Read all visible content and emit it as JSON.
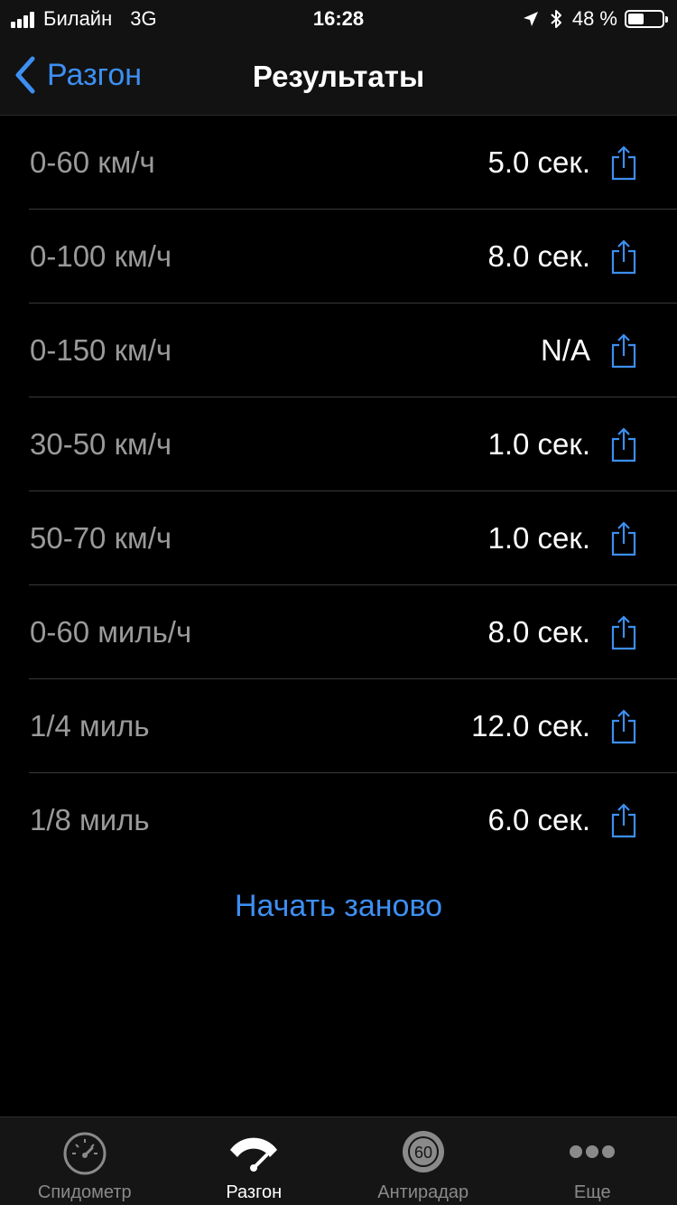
{
  "status_bar": {
    "carrier": "Билайн",
    "network": "3G",
    "time": "16:28",
    "battery_percent": "48 %",
    "battery_level": 0.48,
    "icons": [
      "signal-icon",
      "location-arrow-icon",
      "bluetooth-icon",
      "battery-icon"
    ]
  },
  "nav": {
    "back_label": "Разгон",
    "title": "Результаты"
  },
  "results": [
    {
      "label": "0-60 км/ч",
      "value": "5.0 сек."
    },
    {
      "label": "0-100 км/ч",
      "value": "8.0 сек."
    },
    {
      "label": "0-150 км/ч",
      "value": "N/A"
    },
    {
      "label": "30-50 км/ч",
      "value": "1.0 сек."
    },
    {
      "label": "50-70 км/ч",
      "value": "1.0 сек."
    },
    {
      "label": "0-60 миль/ч",
      "value": "8.0 сек."
    },
    {
      "label": "1/4 миль",
      "value": "12.0 сек."
    },
    {
      "label": "1/8 миль",
      "value": "6.0 сек."
    }
  ],
  "restart_label": "Начать заново",
  "tabs": [
    {
      "label": "Спидометр",
      "icon": "speedometer-icon",
      "active": false
    },
    {
      "label": "Разгон",
      "icon": "acceleration-gauge-icon",
      "active": true
    },
    {
      "label": "Антирадар",
      "icon": "speed-limit-sign-icon",
      "active": false,
      "icon_text": "60"
    },
    {
      "label": "Еще",
      "icon": "more-dots-icon",
      "active": false
    }
  ],
  "colors": {
    "accent": "#3d8ff2",
    "background": "#000000",
    "bar_background": "#121212",
    "label_gray": "#9a9a9a",
    "separator": "#3a3a3c"
  }
}
